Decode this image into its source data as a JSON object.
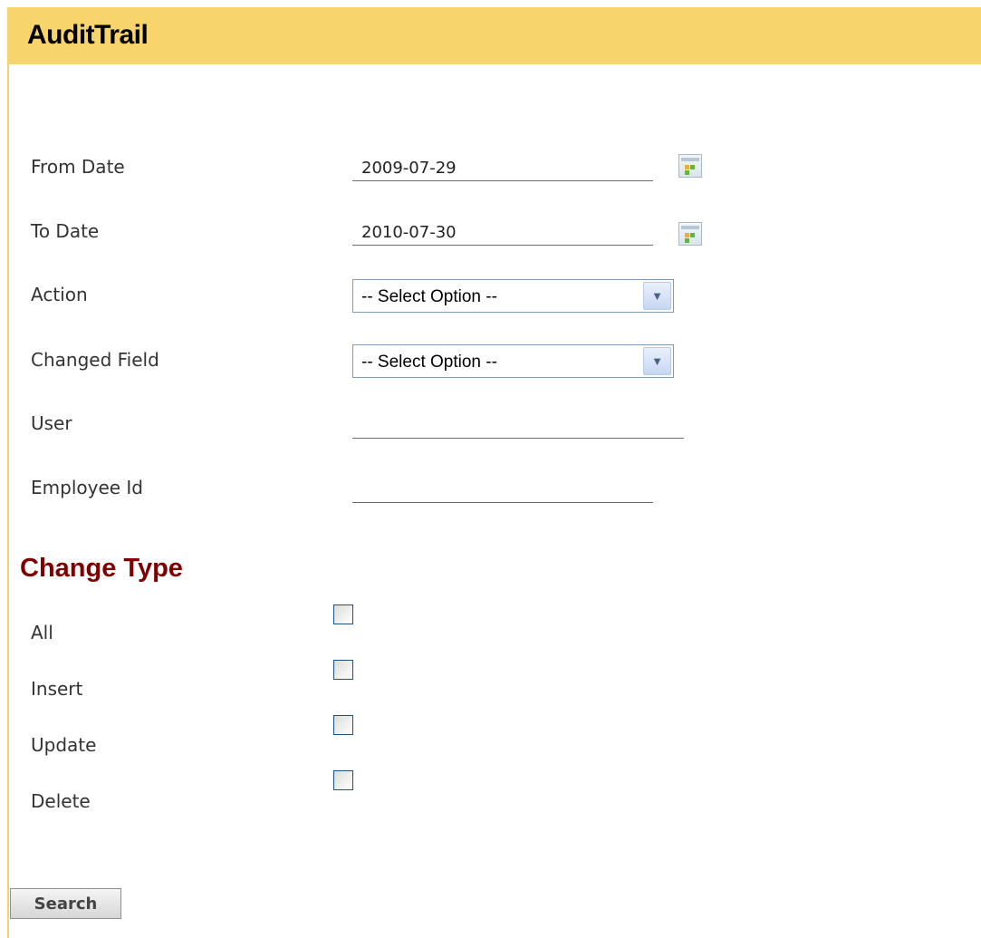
{
  "header": {
    "title": "AuditTrail"
  },
  "form": {
    "from_date": {
      "label": "From Date",
      "value": "2009-07-29"
    },
    "to_date": {
      "label": "To Date",
      "value": "2010-07-30"
    },
    "action": {
      "label": "Action",
      "selected": "-- Select Option --"
    },
    "changed_field": {
      "label": "Changed Field",
      "selected": "-- Select Option --"
    },
    "user": {
      "label": "User",
      "value": ""
    },
    "employee_id": {
      "label": "Employee Id",
      "value": ""
    }
  },
  "change_type": {
    "heading": "Change Type",
    "options": [
      {
        "label": "All",
        "checked": false
      },
      {
        "label": "Insert",
        "checked": false
      },
      {
        "label": "Update",
        "checked": false
      },
      {
        "label": "Delete",
        "checked": false
      }
    ]
  },
  "buttons": {
    "search": "Search"
  },
  "icons": {
    "calendar": "calendar-icon",
    "dropdown": "chevron-down-icon"
  },
  "colors": {
    "header_bg": "#f8d46c",
    "heading_text": "#800000",
    "panel_border": "#f7d06a"
  }
}
